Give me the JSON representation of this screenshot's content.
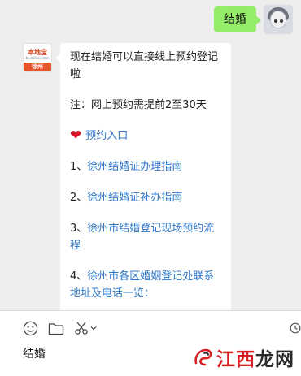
{
  "conversation": {
    "outgoing_message": "结婚",
    "incoming": {
      "avatar": {
        "brand": "本地宝",
        "site": "BenDibao.com",
        "city": "徐州"
      },
      "intro": "现在结婚可以直接线上预约登记啦",
      "note": "注：网上预约需提前2至30天",
      "booking_link": "预约入口",
      "items": [
        {
          "number": "1、",
          "text": "徐州结婚证办理指南"
        },
        {
          "number": "2、",
          "text": "徐州结婚证补办指南"
        },
        {
          "number": "3、",
          "text": "徐州市结婚登记现场预约流程"
        },
        {
          "number": "4、",
          "text": "徐州市各区婚姻登记处联系地址及电话一览："
        }
      ]
    }
  },
  "composer": {
    "input_text": "结婚",
    "tools": [
      "emoji-icon",
      "folder-icon",
      "scissors-icon",
      "chevron-down-icon",
      "history-icon"
    ]
  },
  "watermark": {
    "red": "江西",
    "dark": "龙网"
  },
  "colors": {
    "outgoing_bubble": "#95ec69",
    "link": "#2f77c9",
    "heart": "#d4172b",
    "chat_bg": "#ededed"
  }
}
